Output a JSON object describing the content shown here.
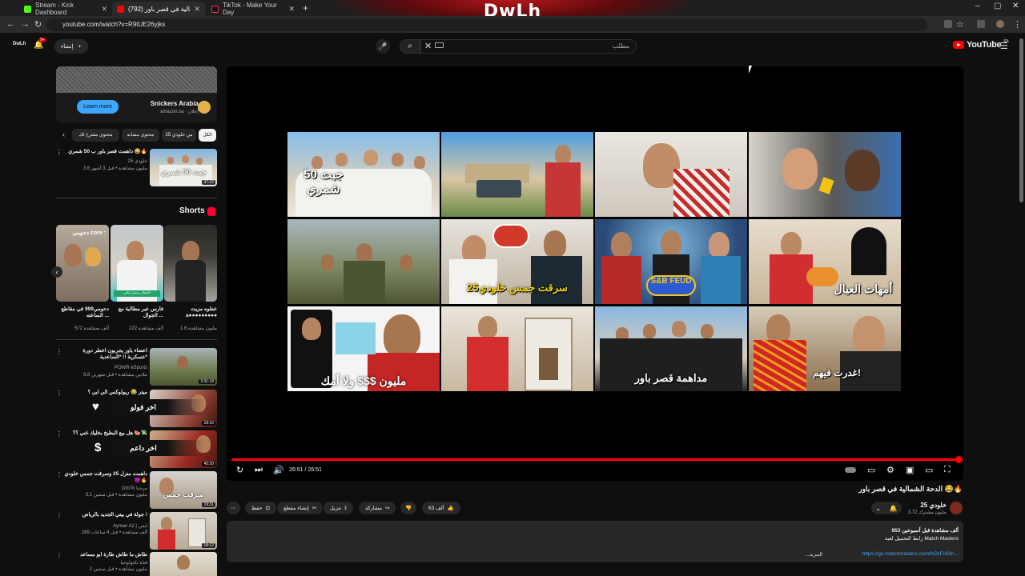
{
  "browser": {
    "tabs": [
      {
        "label": "Stream - Kick Dashboard",
        "favicon_color": "#53fc18"
      },
      {
        "label": "(792) الدحة الشمالية في قصر باور",
        "favicon_color": "#ff0000"
      },
      {
        "label": "TikTok - Make Your Day",
        "favicon_color": "#111111"
      }
    ],
    "new_tab": "+",
    "close_glyph": "✕",
    "url": "youtube.com/watch?v=R9tUE26yjks",
    "window_controls": [
      "–",
      "▢",
      "✕"
    ],
    "overlay_logo": "DwLh"
  },
  "header": {
    "create_label": "إنشاء",
    "create_glyph": "+",
    "notification_count": "9+",
    "search_placeholder": "مطلب",
    "youtube_logo_text": "YouTube",
    "region": "SA"
  },
  "ad": {
    "name": "Snickers Arabia",
    "sponsor_line": "amazon.sa · إعلان",
    "cta": "Learn more"
  },
  "chips": [
    "الكل",
    "من خلودي 25",
    "محتوى مشابه",
    "محتوى مقترح لك"
  ],
  "related_top": {
    "title": "داهمت قصر باور ب 50 شمري 😂🔥",
    "channel": "خلودي 25",
    "meta": "3.6 مليون مشاهدة • قبل 3 أشهر",
    "duration": "37:22",
    "thumb_caption": "جبت 50 شمري"
  },
  "shorts": {
    "title": "Shorts",
    "items": [
      {
        "title": "عطوه مزيت ⁦⁩a●●●●●●●●●",
        "views": "1.6 مليون مشاهدة"
      },
      {
        "title": "فارس عبر مطالبة مع الجوال ...",
        "views": "222 ألف مشاهدة"
      },
      {
        "title": "دحومي999 في مقاطع الساعته ...",
        "views": "572 ألف مشاهدة"
      }
    ],
    "overlay_label": "دحومي core :"
  },
  "related": [
    {
      "title": "اعضاء باور يجربون اخطر دورة عسكرية !! *الساعدية*",
      "channel": "POWR eSports",
      "meta": "9.8 ملايين مشاهدة • قبل شهرين",
      "duration": "3:31:18"
    },
    {
      "title": "ميتر 😂 ريولوكس الي ابن ؟",
      "channel": "",
      "meta": "",
      "duration": "18:10",
      "overlay": "اخر فولو"
    },
    {
      "title": "هل بيع البطيخ بخليك غني ؟؟ 🍉💸",
      "channel": "",
      "meta": "",
      "duration": "45:20",
      "overlay": "اخر داعم"
    },
    {
      "title": "داهمت منزل 25 وسرقت جمس خلودي 😈🔥",
      "channel": "Drb7h مرحبا",
      "meta": "3.1 مليون مشاهدة • قبل سنتين",
      "duration": "19:31"
    },
    {
      "title": "جولة في بيتي الجديد بالرياض !",
      "channel": "Ayman Az | ايمن",
      "meta": "169 ألف مشاهدة • قبل 4 ساعات",
      "duration": "18:12"
    },
    {
      "title": "طاش ما طاش طارة أبو مساعد",
      "channel": "قناة تكنولوجيا",
      "meta": "2 مليون مشاهدة • قبل سنتين",
      "duration": ""
    }
  ],
  "overlay_icons": {
    "heart": "♥",
    "dollar": "$"
  },
  "player": {
    "time": "26:51 / 26:51",
    "progress_fraction": 1.0,
    "grid_captions": [
      "جبت 50 شمري",
      "",
      "",
      "",
      "",
      "سرقت جمس خلودي25",
      "S&B FEUD",
      "أمهات العيال",
      "مليون $$$ ولا أمك",
      "",
      "مداهمة قصر باور",
      "غدرت فيهم!"
    ]
  },
  "video": {
    "title": "الدحة الشمالية في قصر باور 😂🔥",
    "channel_name": "خلودي 25",
    "subscribers": "3.72 مليون مشترك",
    "likes": "63 ألف",
    "actions": [
      "مشاركة",
      "تنزيل",
      "إنشاء مقطع",
      "حفظ"
    ],
    "more_glyph": "⋯"
  },
  "description": {
    "line1": "953 ألف مشاهدة  قبل أسبوعين",
    "line2": "رابط التحميل لعبة Match Masters",
    "link": "https://go.matchmasters.com/hCkF/42ln...",
    "more_label": "...المزيد"
  }
}
